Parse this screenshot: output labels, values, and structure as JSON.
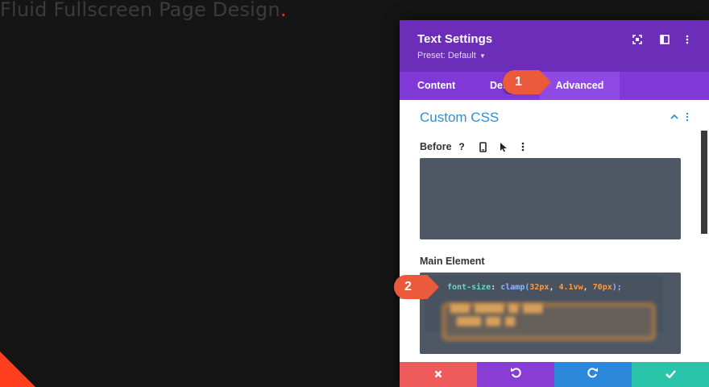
{
  "page": {
    "heading": "Fluid Fullscreen Page Design",
    "heading_dot": ".",
    "accent_color": "#ff2a1a"
  },
  "panel": {
    "title": "Text Settings",
    "preset": "Preset: Default",
    "header_icons": [
      "expand-icon",
      "sidebar-layout-icon",
      "more-vertical-icon"
    ],
    "tabs": [
      {
        "label": "Content",
        "active": false
      },
      {
        "label": "Design",
        "active": false
      },
      {
        "label": "Advanced",
        "active": true
      }
    ],
    "section": {
      "title": "Custom CSS",
      "expanded": true
    },
    "fields": {
      "before": {
        "label": "Before",
        "icons": [
          "help-icon",
          "mobile-icon",
          "pointer-icon",
          "more-vertical-icon"
        ],
        "value": ""
      },
      "main_element": {
        "label": "Main Element",
        "code_prop": "font-size",
        "code_colon": ": ",
        "code_fn": "clamp(",
        "code_arg1": "32px",
        "code_sep1": ", ",
        "code_arg2": "4.1vw",
        "code_sep2": ", ",
        "code_arg3": "70px",
        "code_end": ");"
      }
    },
    "footer_buttons": [
      "cancel-icon",
      "undo-icon",
      "redo-icon",
      "save-check-icon"
    ],
    "colors": {
      "header": "#6c2eb9",
      "tabs": "#8039d6",
      "link": "#2f8fd1",
      "cancel": "#ef5b5b",
      "undo": "#8a3dd2",
      "redo": "#2b87da",
      "save": "#29c4a9"
    }
  },
  "callouts": [
    {
      "number": "1"
    },
    {
      "number": "2"
    }
  ]
}
